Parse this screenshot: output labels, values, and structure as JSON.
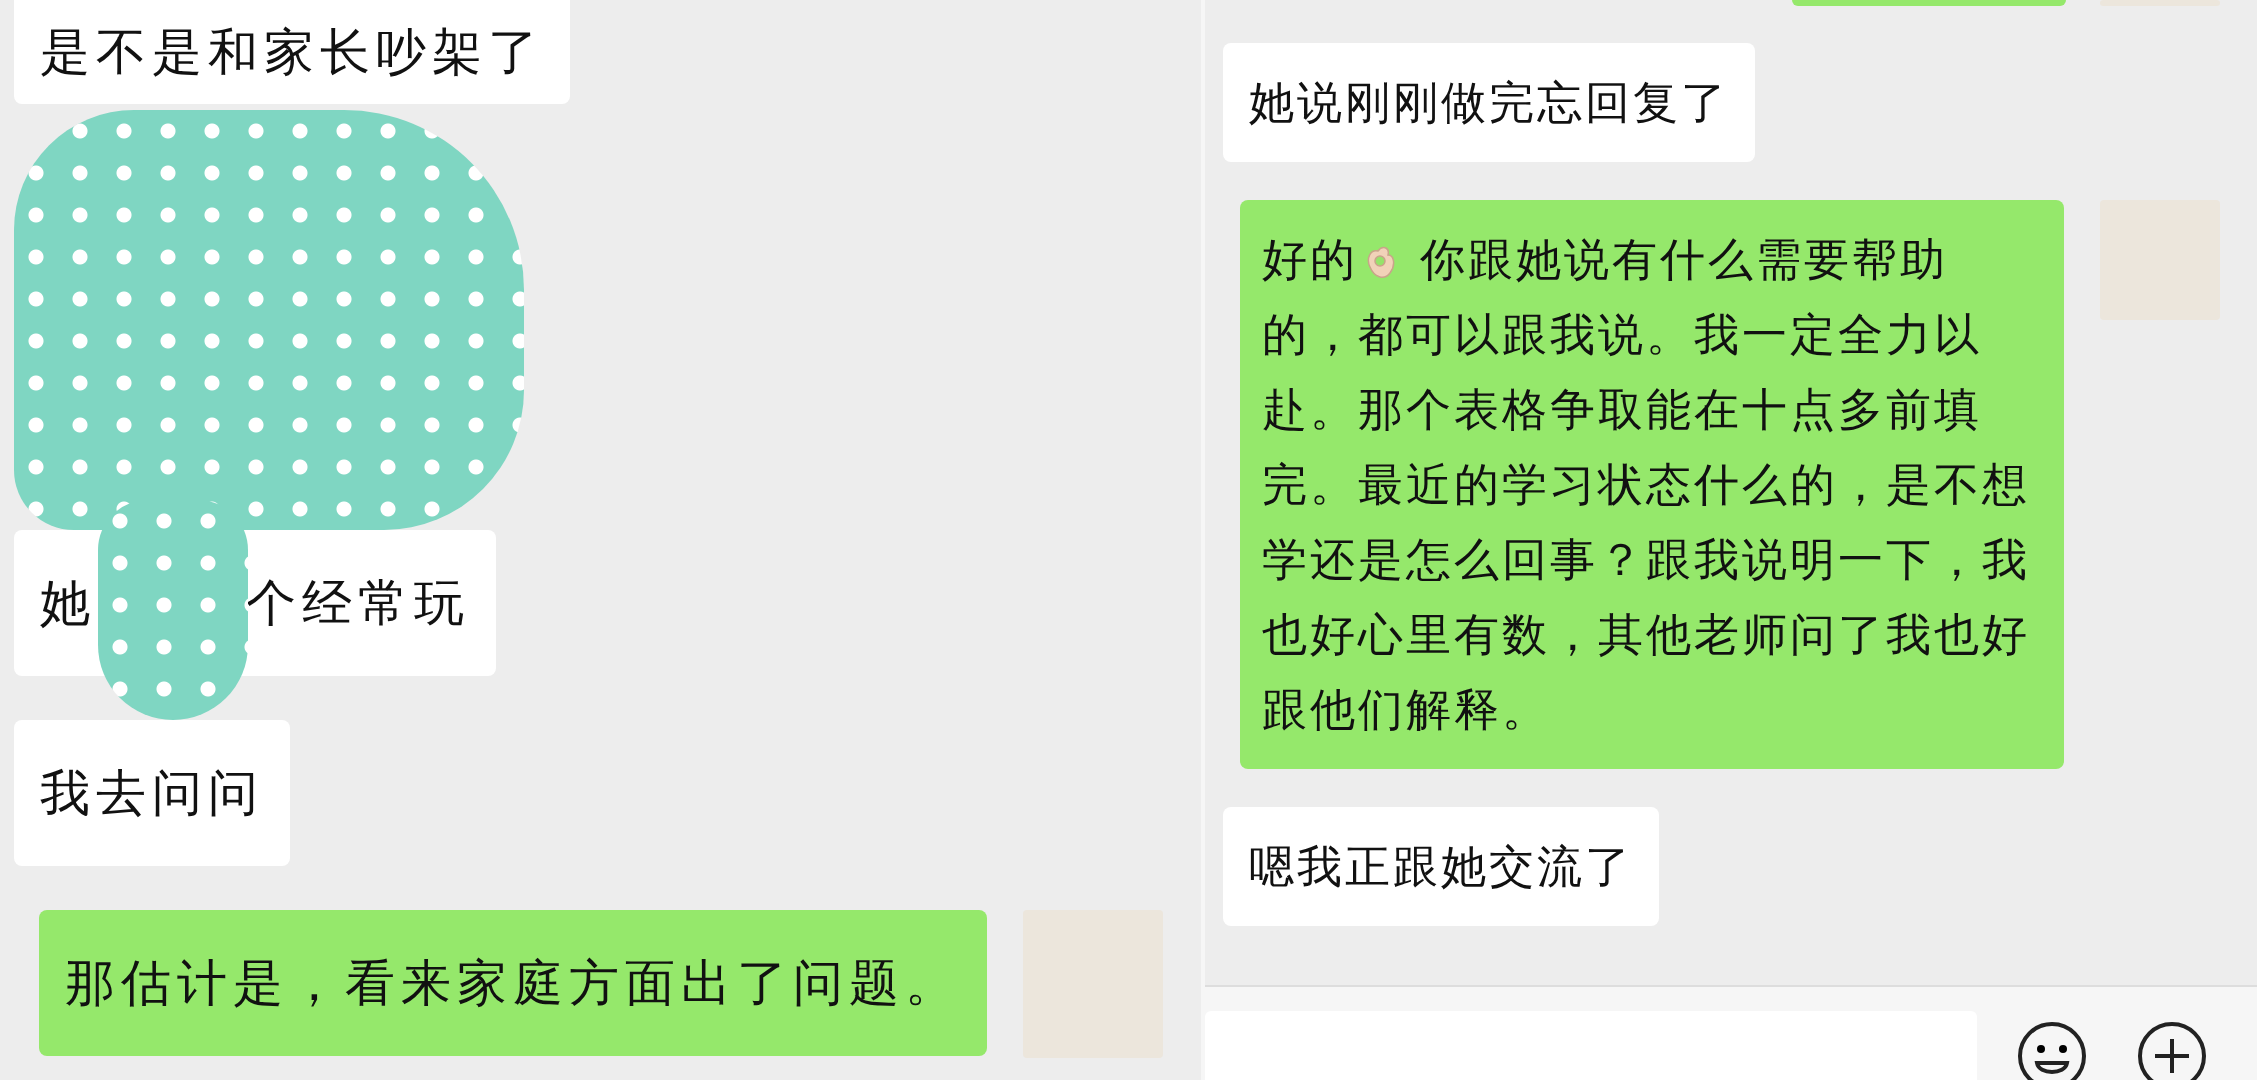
{
  "panels": [
    {
      "has_input_bar": false,
      "messages": [
        {
          "kind": "in",
          "text": "是不是和家长吵架了"
        },
        {
          "kind": "mask"
        },
        {
          "kind": "in_masked",
          "parts": [
            "她",
            "个经常玩"
          ]
        },
        {
          "kind": "in",
          "text": "我去问问"
        },
        {
          "kind": "out",
          "text": "那估计是，看来家庭方面出了问题。"
        }
      ]
    },
    {
      "has_input_bar": true,
      "messages": [
        {
          "kind": "stub_out"
        },
        {
          "kind": "in",
          "text": "她说刚刚做完忘回复了"
        },
        {
          "kind": "out_emoji",
          "parts": [
            "好的",
            "你跟她说有什么需要帮助",
            "的，都可以跟我说。我一定全力以赴。那个表格争取能在十点多前填完。最近的学习状态什么的，是不想学还是怎么回事？跟我说明一下，我也好心里有数，其他老师问了我也好跟他们解释。"
          ]
        },
        {
          "kind": "in",
          "text": "嗯我正跟她交流了"
        }
      ]
    }
  ]
}
